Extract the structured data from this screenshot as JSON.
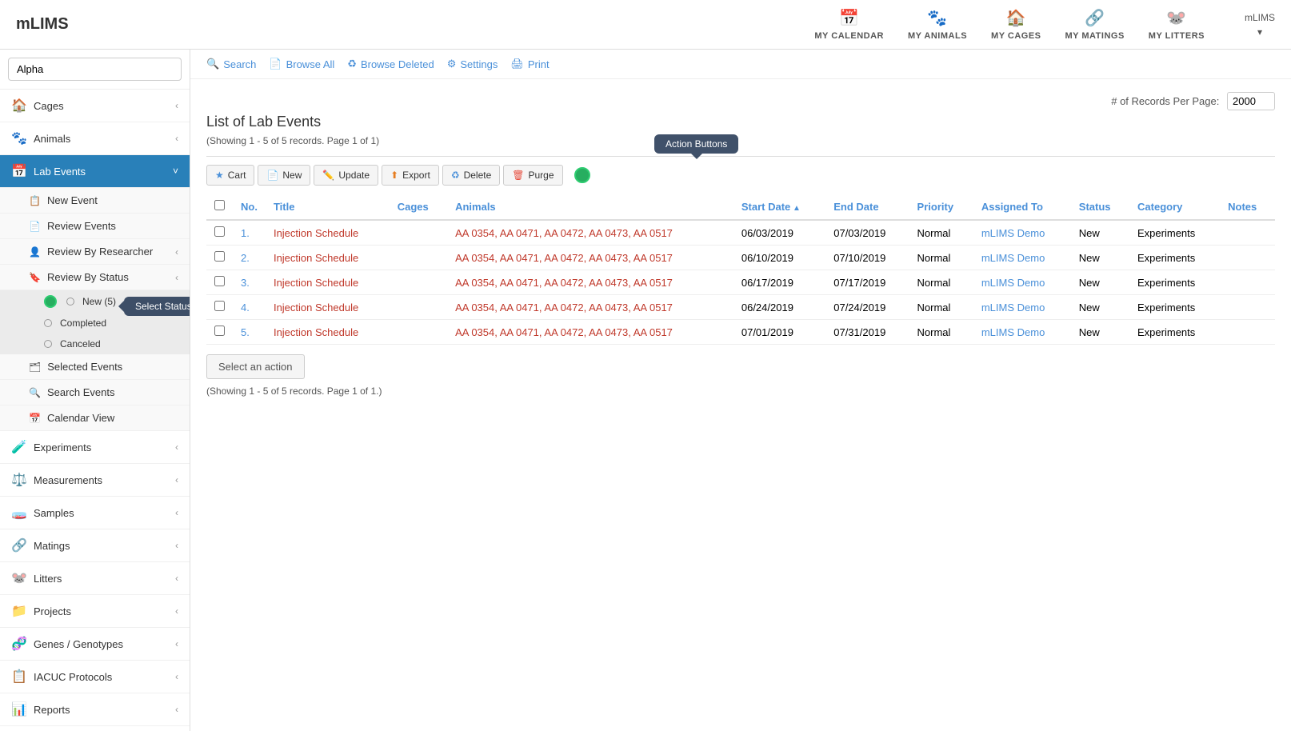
{
  "brand": "mLIMS",
  "hamburger": "☰",
  "top_nav": {
    "items": [
      {
        "id": "calendar",
        "icon": "📅",
        "label": "MY CALENDAR"
      },
      {
        "id": "animals",
        "icon": "🐾",
        "label": "MY ANIMALS"
      },
      {
        "id": "cages",
        "icon": "🏠",
        "label": "MY CAGES"
      },
      {
        "id": "matings",
        "icon": "🔗",
        "label": "MY MATINGS"
      },
      {
        "id": "litters",
        "icon": "🐭",
        "label": "MY LITTERS"
      }
    ],
    "user_label": "mLIMS",
    "user_arrow": "▾"
  },
  "sidebar": {
    "search_placeholder": "Alpha",
    "items": [
      {
        "id": "cages",
        "icon": "🏠",
        "label": "Cages",
        "has_arrow": true
      },
      {
        "id": "animals",
        "icon": "🐾",
        "label": "Animals",
        "has_arrow": true
      },
      {
        "id": "lab-events",
        "icon": "📅",
        "label": "Lab Events",
        "active": true,
        "has_arrow": true
      }
    ],
    "lab_events_sub": [
      {
        "id": "new-event",
        "icon": "📋",
        "label": "New Event"
      },
      {
        "id": "review-events",
        "icon": "📄",
        "label": "Review Events"
      },
      {
        "id": "review-by-researcher",
        "icon": "👤",
        "label": "Review By Researcher",
        "has_arrow": true
      },
      {
        "id": "review-by-status",
        "icon": "🔖",
        "label": "Review By Status",
        "has_arrow": true
      }
    ],
    "review_by_status_sub": [
      {
        "id": "new-status",
        "label": "New (5)"
      },
      {
        "id": "completed-status",
        "label": "Completed"
      },
      {
        "id": "canceled-status",
        "label": "Canceled"
      }
    ],
    "more_items": [
      {
        "id": "selected-events",
        "icon": "🗂",
        "label": "Selected Events"
      },
      {
        "id": "search-events",
        "icon": "🔍",
        "label": "Search Events"
      },
      {
        "id": "calendar-view",
        "icon": "📅",
        "label": "Calendar View"
      }
    ],
    "bottom_items": [
      {
        "id": "experiments",
        "icon": "🧪",
        "label": "Experiments",
        "has_arrow": true
      },
      {
        "id": "measurements",
        "icon": "⚖️",
        "label": "Measurements",
        "has_arrow": true
      },
      {
        "id": "samples",
        "icon": "🧫",
        "label": "Samples",
        "has_arrow": true
      },
      {
        "id": "matings",
        "icon": "🔗",
        "label": "Matings",
        "has_arrow": true
      },
      {
        "id": "litters",
        "icon": "🐭",
        "label": "Litters",
        "has_arrow": true
      },
      {
        "id": "projects",
        "icon": "📁",
        "label": "Projects",
        "has_arrow": true
      },
      {
        "id": "genes",
        "icon": "🧬",
        "label": "Genes / Genotypes",
        "has_arrow": true
      },
      {
        "id": "iacuc",
        "icon": "📋",
        "label": "IACUC Protocols",
        "has_arrow": true
      },
      {
        "id": "reports",
        "icon": "📊",
        "label": "Reports",
        "has_arrow": true
      }
    ],
    "select_status_tooltip": "Select Status"
  },
  "toolbar": {
    "search_label": "Search",
    "browse_all_label": "Browse All",
    "browse_deleted_label": "Browse Deleted",
    "settings_label": "Settings",
    "print_label": "Print"
  },
  "content": {
    "records_per_page_label": "# of Records Per Page:",
    "records_per_page_value": "2000",
    "page_title": "List of Lab Events",
    "showing_top": "(Showing 1 - 5 of 5 records. Page 1 of 1)",
    "action_buttons_tooltip": "Action Buttons",
    "buttons": [
      {
        "id": "cart",
        "icon": "★",
        "label": "Cart"
      },
      {
        "id": "new",
        "icon": "📄",
        "label": "New"
      },
      {
        "id": "update",
        "icon": "✏️",
        "label": "Update"
      },
      {
        "id": "export",
        "icon": "⬆",
        "label": "Export"
      },
      {
        "id": "delete",
        "icon": "🔄",
        "label": "Delete"
      },
      {
        "id": "purge",
        "icon": "🗑",
        "label": "Purge"
      }
    ],
    "table": {
      "columns": [
        {
          "id": "no",
          "label": "No."
        },
        {
          "id": "title",
          "label": "Title"
        },
        {
          "id": "cages",
          "label": "Cages"
        },
        {
          "id": "animals",
          "label": "Animals"
        },
        {
          "id": "start_date",
          "label": "Start Date",
          "sort": "asc"
        },
        {
          "id": "end_date",
          "label": "End Date"
        },
        {
          "id": "priority",
          "label": "Priority"
        },
        {
          "id": "assigned_to",
          "label": "Assigned To"
        },
        {
          "id": "status",
          "label": "Status"
        },
        {
          "id": "category",
          "label": "Category"
        },
        {
          "id": "notes",
          "label": "Notes"
        }
      ],
      "rows": [
        {
          "no": "1.",
          "title": "Injection Schedule",
          "cages": "",
          "animals": "AA 0354, AA 0471, AA 0472, AA 0473, AA 0517",
          "start_date": "06/03/2019",
          "end_date": "07/03/2019",
          "priority": "Normal",
          "assigned_to": "mLIMS Demo",
          "status": "New",
          "category": "Experiments",
          "notes": ""
        },
        {
          "no": "2.",
          "title": "Injection Schedule",
          "cages": "",
          "animals": "AA 0354, AA 0471, AA 0472, AA 0473, AA 0517",
          "start_date": "06/10/2019",
          "end_date": "07/10/2019",
          "priority": "Normal",
          "assigned_to": "mLIMS Demo",
          "status": "New",
          "category": "Experiments",
          "notes": ""
        },
        {
          "no": "3.",
          "title": "Injection Schedule",
          "cages": "",
          "animals": "AA 0354, AA 0471, AA 0472, AA 0473, AA 0517",
          "start_date": "06/17/2019",
          "end_date": "07/17/2019",
          "priority": "Normal",
          "assigned_to": "mLIMS Demo",
          "status": "New",
          "category": "Experiments",
          "notes": ""
        },
        {
          "no": "4.",
          "title": "Injection Schedule",
          "cages": "",
          "animals": "AA 0354, AA 0471, AA 0472, AA 0473, AA 0517",
          "start_date": "06/24/2019",
          "end_date": "07/24/2019",
          "priority": "Normal",
          "assigned_to": "mLIMS Demo",
          "status": "New",
          "category": "Experiments",
          "notes": ""
        },
        {
          "no": "5.",
          "title": "Injection Schedule",
          "cages": "",
          "animals": "AA 0354, AA 0471, AA 0472, AA 0473, AA 0517",
          "start_date": "07/01/2019",
          "end_date": "07/31/2019",
          "priority": "Normal",
          "assigned_to": "mLIMS Demo",
          "status": "New",
          "category": "Experiments",
          "notes": ""
        }
      ]
    },
    "select_action_label": "Select an action",
    "showing_bottom": "(Showing 1 - 5 of 5 records. Page 1 of 1.)"
  }
}
